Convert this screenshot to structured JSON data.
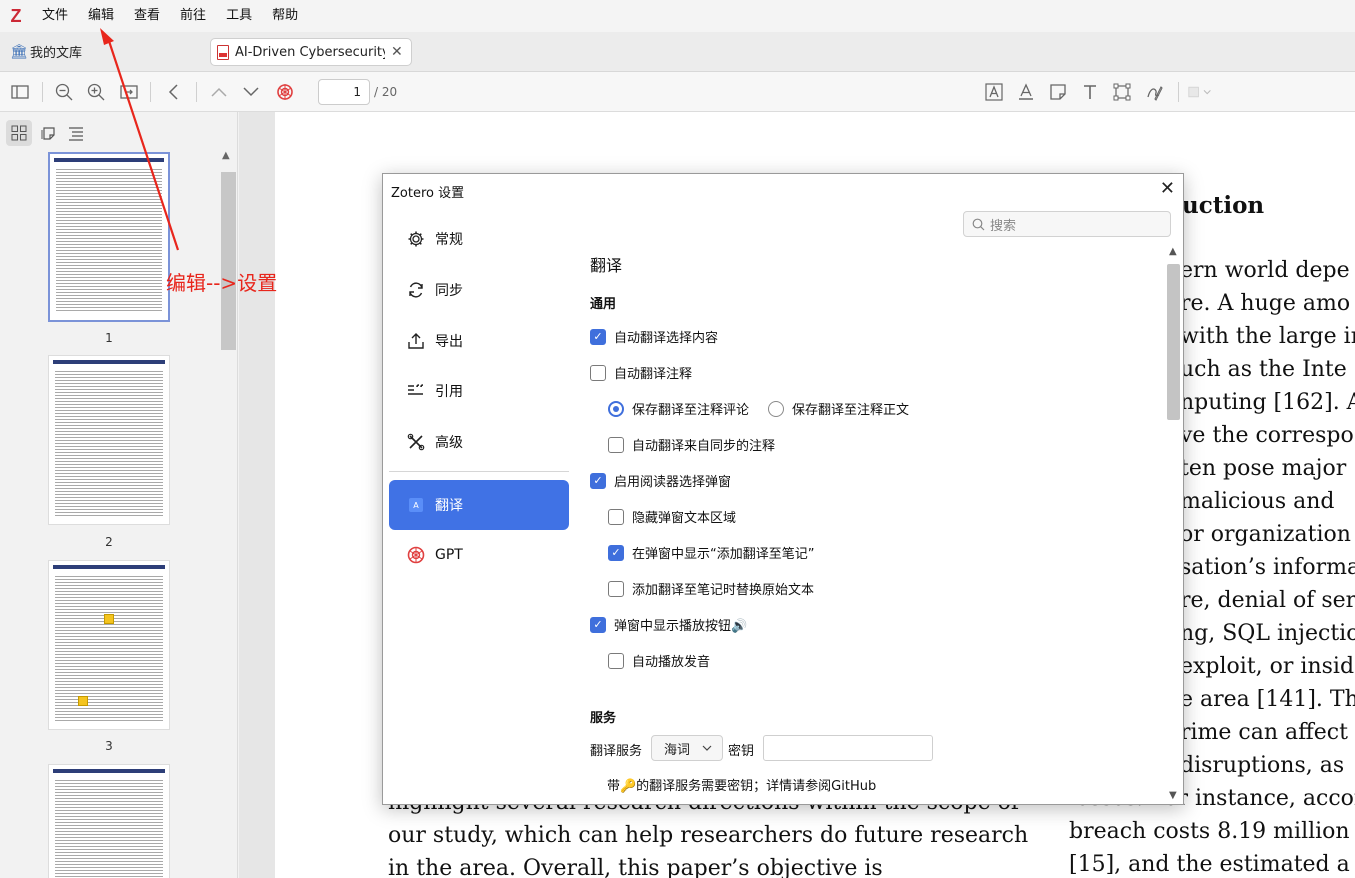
{
  "app": {
    "logo": "Z"
  },
  "menu": [
    "文件",
    "编辑",
    "查看",
    "前往",
    "工具",
    "帮助"
  ],
  "tabs": {
    "library": "我的文库",
    "document": "AI-Driven Cybersecurity: An"
  },
  "toolbar": {
    "page_current": "1",
    "page_total": "/ 20"
  },
  "sidebar": {
    "thumb_labels": [
      "1",
      "2",
      "3"
    ]
  },
  "annotation": {
    "text": "编辑-->设置",
    "color": "#e8261c"
  },
  "paper": {
    "heading": "uction",
    "right_lines": [
      "ern world depe",
      "re. A huge amo",
      "with the large in",
      "uch as the Inte",
      "nputing [162]. A",
      "ve the correspo",
      "ten pose major",
      " malicious and",
      "or organization",
      "sation’s informa",
      "re, denial of ser",
      "ng, SQL injectio",
      "exploit, or insid",
      "e area [141]. Th",
      "rime can affect",
      " disruptions, as",
      "losses. For instance, accor",
      "breach costs 8.19 million",
      "[15], and the estimated a"
    ],
    "left_lines": [
      "highlight several research directions within the scope of",
      "our study, which can help researchers do future research",
      "in the area. Overall, this paper’s objective is"
    ]
  },
  "dialog": {
    "title": "Zotero 设置",
    "search_placeholder": "搜索",
    "nav": [
      {
        "label": "常规",
        "icon": "gear-icon"
      },
      {
        "label": "同步",
        "icon": "sync-icon"
      },
      {
        "label": "导出",
        "icon": "export-icon"
      },
      {
        "label": "引用",
        "icon": "cite-icon"
      },
      {
        "label": "高级",
        "icon": "tools-icon"
      },
      {
        "label": "翻译",
        "icon": "translate-icon"
      },
      {
        "label": "GPT",
        "icon": "gpt-icon"
      }
    ],
    "active_nav": "翻译",
    "section_title": "翻译",
    "general_group": "通用",
    "options": {
      "auto_translate_selection": {
        "label": "自动翻译选择内容",
        "checked": true
      },
      "auto_translate_annotation": {
        "label": "自动翻译注释",
        "checked": false
      },
      "save_to_comment": {
        "label": "保存翻译至注释评论",
        "selected": true
      },
      "save_to_body": {
        "label": "保存翻译至注释正文",
        "selected": false
      },
      "auto_translate_synced": {
        "label": "自动翻译来自同步的注释",
        "checked": false
      },
      "enable_popup": {
        "label": "启用阅读器选择弹窗",
        "checked": true
      },
      "hide_popup_text": {
        "label": "隐藏弹窗文本区域",
        "checked": false
      },
      "show_add_to_note": {
        "label": "在弹窗中显示“添加翻译至笔记”",
        "checked": true
      },
      "replace_original": {
        "label": "添加翻译至笔记时替换原始文本",
        "checked": false
      },
      "show_play_button": {
        "label": "弹窗中显示播放按钮🔊",
        "checked": true
      },
      "auto_play": {
        "label": "自动播放发音",
        "checked": false
      }
    },
    "service_group": "服务",
    "service_label": "翻译服务",
    "service_value": "海词",
    "key_label": "密钥",
    "key_value": "",
    "footnote": "带🔑的翻译服务需要密钥；详情请参阅GitHub"
  },
  "colors": {
    "accent": "#4072e5",
    "zotero_red": "#cc2936"
  }
}
